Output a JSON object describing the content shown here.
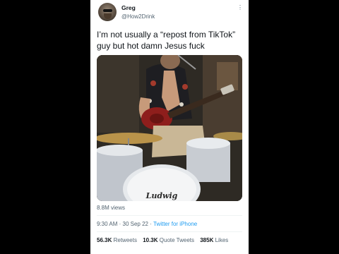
{
  "user": {
    "name": "Greg",
    "handle": "@How2Drink"
  },
  "tweet": {
    "text": "I’m not usually a “repost from TikTok” guy but hot damn Jesus fuck",
    "views": "8.8M views",
    "time": "9:30 AM",
    "date": "30 Sep 22",
    "source": "Twitter for iPhone",
    "separator": "·"
  },
  "media": {
    "drum_logo": "Ludwig"
  },
  "stats": {
    "retweets_count": "56.3K",
    "retweets_label": "Retweets",
    "quotes_count": "10.3K",
    "quotes_label": "Quote Tweets",
    "likes_count": "385K",
    "likes_label": "Likes"
  },
  "icons": {
    "more": "more-icon",
    "tiktok": "tiktok-icon"
  },
  "colors": {
    "link": "#1d9bf0",
    "text": "#0f1419",
    "secondary": "#536471",
    "background": "#000000"
  }
}
